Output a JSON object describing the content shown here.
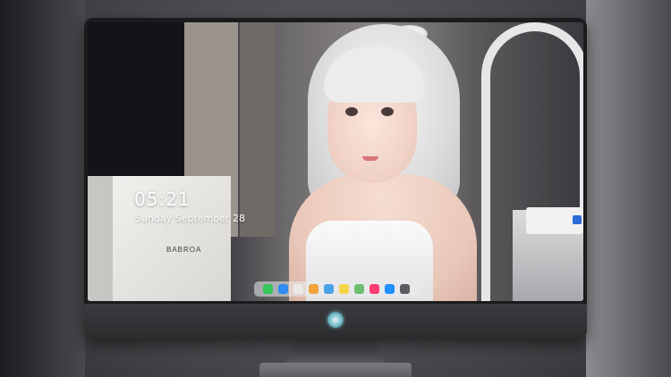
{
  "lock_screen": {
    "time": "05:21",
    "date": "Sunday September  28",
    "notice": ""
  },
  "box_label": "BABROA",
  "dock": {
    "icons": [
      {
        "name": "messages-icon",
        "color": "#34c759"
      },
      {
        "name": "finder-icon",
        "color": "#2f8cf0"
      },
      {
        "name": "safari-icon",
        "color": "#eaeaea"
      },
      {
        "name": "photos-icon",
        "color": "#f2a33a"
      },
      {
        "name": "files-icon",
        "color": "#4aa3e8"
      },
      {
        "name": "notes-icon",
        "color": "#f5d547"
      },
      {
        "name": "maps-icon",
        "color": "#6cc070"
      },
      {
        "name": "music-icon",
        "color": "#fc3d72"
      },
      {
        "name": "app-store-icon",
        "color": "#1e90ff"
      },
      {
        "name": "camera-icon",
        "color": "#5b5b60"
      }
    ]
  }
}
